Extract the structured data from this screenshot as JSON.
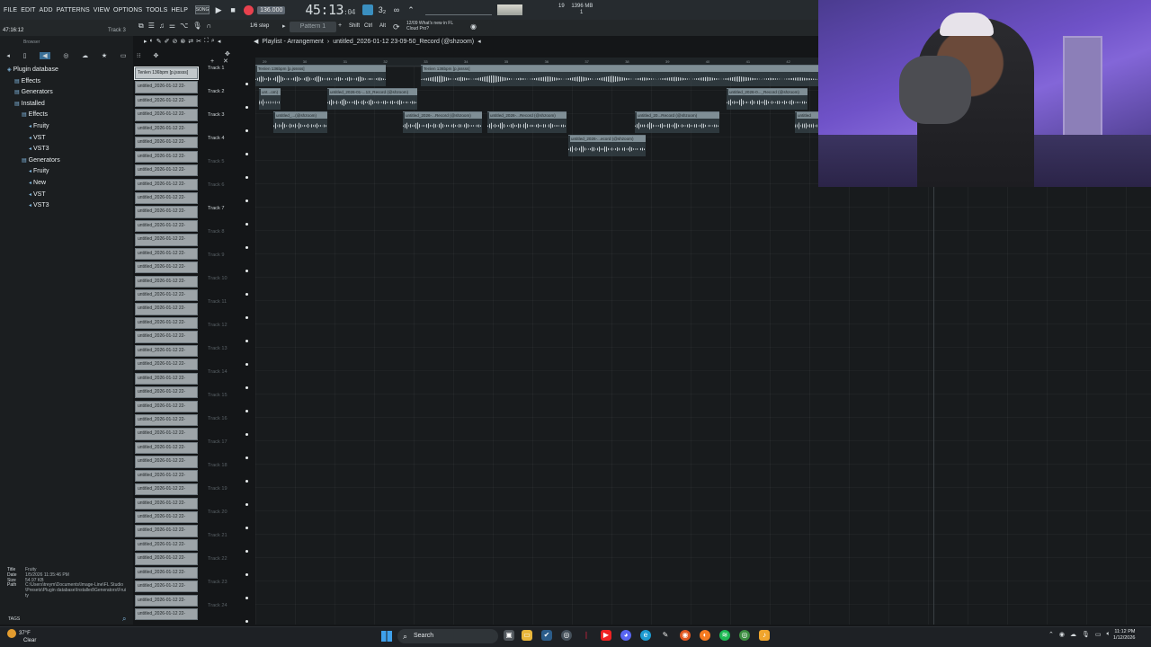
{
  "menu": [
    "FILE",
    "EDIT",
    "ADD",
    "PATTERNS",
    "VIEW",
    "OPTIONS",
    "TOOLS",
    "HELP"
  ],
  "transport": {
    "song_mode": "SONG",
    "tempo": "136.000",
    "time": "45:13",
    "time_ms": ":04",
    "cpu": "19",
    "memory": "1396 MB",
    "voices": "1"
  },
  "toolbar": {
    "time_left": "47:16:12",
    "track_label": "Track 3",
    "step": "1/6 step",
    "pattern": "Pattern 1",
    "keys": [
      "Shift",
      "Ctrl",
      "Alt"
    ],
    "news_date": "12/09",
    "news_title": "What's new in FL",
    "news_sub": "Cloud Pro?"
  },
  "browser": {
    "title": "Browser",
    "tree": [
      {
        "label": "Plugin database",
        "indent": 0
      },
      {
        "label": "Effects",
        "indent": 1
      },
      {
        "label": "Generators",
        "indent": 1
      },
      {
        "label": "Installed",
        "indent": 1
      },
      {
        "label": "Effects",
        "indent": 2
      },
      {
        "label": "Fruity",
        "indent": 3
      },
      {
        "label": "VST",
        "indent": 3
      },
      {
        "label": "VST3",
        "indent": 3
      },
      {
        "label": "Generators",
        "indent": 2
      },
      {
        "label": "Fruity",
        "indent": 3
      },
      {
        "label": "New",
        "indent": 3
      },
      {
        "label": "VST",
        "indent": 3
      },
      {
        "label": "VST3",
        "indent": 3
      }
    ],
    "info": {
      "title_key": "Title",
      "title": "Fruity",
      "date_key": "Date",
      "date": "1/5/2026 11:35:46 PM",
      "size_key": "Size",
      "size": "54.97 KB",
      "path_key": "Path",
      "path": "C:\\Users\\treym\\Documents\\Image-Line\\FL Studio\\Presets\\Plugin database\\Installed\\Generators\\Fruity"
    },
    "tags": "TAGS"
  },
  "clips": {
    "first": "Tenlen 136bpm [p.jsssss]",
    "repeat": "untitled_2026-01-12 22-",
    "count": 40
  },
  "playlist": {
    "title": "Playlist - Arrangement",
    "arrangement": "untitled_2026-01-12 23-09-50_Record (@shzoom)",
    "ruler": [
      "29",
      "30",
      "31",
      "32",
      "33",
      "34",
      "35",
      "36",
      "37",
      "38",
      "39",
      "40",
      "41",
      "42"
    ],
    "tracks": [
      "Track 1",
      "Track 2",
      "Track 3",
      "Track 4",
      "Track 5",
      "Track 6",
      "Track 7",
      "Track 8",
      "Track 9",
      "Track 10",
      "Track 11",
      "Track 12",
      "Track 13",
      "Track 14",
      "Track 15",
      "Track 16",
      "Track 17",
      "Track 18",
      "Track 19",
      "Track 20",
      "Track 21",
      "Track 22",
      "Track 23",
      "Track 24"
    ],
    "audio_clips": [
      {
        "track": 1,
        "start": 0,
        "end": 145,
        "label": "Tenlen 136bpm [p.jsssss]"
      },
      {
        "track": 1,
        "start": 184,
        "end": 626,
        "label": "Tenlen 136bpm [p.jsssss]"
      },
      {
        "track": 2,
        "start": 4,
        "end": 28,
        "label": "unt...om)"
      },
      {
        "track": 2,
        "start": 80,
        "end": 180,
        "label": "untitled_2026-01-...13_Record (@shzoom)"
      },
      {
        "track": 2,
        "start": 524,
        "end": 614,
        "label": "untitled_2026-0..._Record (@shzoom)"
      },
      {
        "track": 3,
        "start": 20,
        "end": 80,
        "label": "untitled_...(@shzoom)"
      },
      {
        "track": 3,
        "start": 164,
        "end": 252,
        "label": "untitled_2026-...Record (@shzoom)"
      },
      {
        "track": 3,
        "start": 258,
        "end": 346,
        "label": "untitled_2026-...Record (@shzoom)"
      },
      {
        "track": 3,
        "start": 422,
        "end": 516,
        "label": "untitled_20...Record (@shzoom)"
      },
      {
        "track": 3,
        "start": 600,
        "end": 626,
        "label": "untitled"
      },
      {
        "track": 4,
        "start": 348,
        "end": 434,
        "label": "untitled_2026-...ecord (@shzoom)"
      }
    ]
  },
  "taskbar": {
    "temp": "37°F",
    "weather": "Clear",
    "search": "Search",
    "time": "11:12 PM",
    "date": "1/12/2026"
  }
}
